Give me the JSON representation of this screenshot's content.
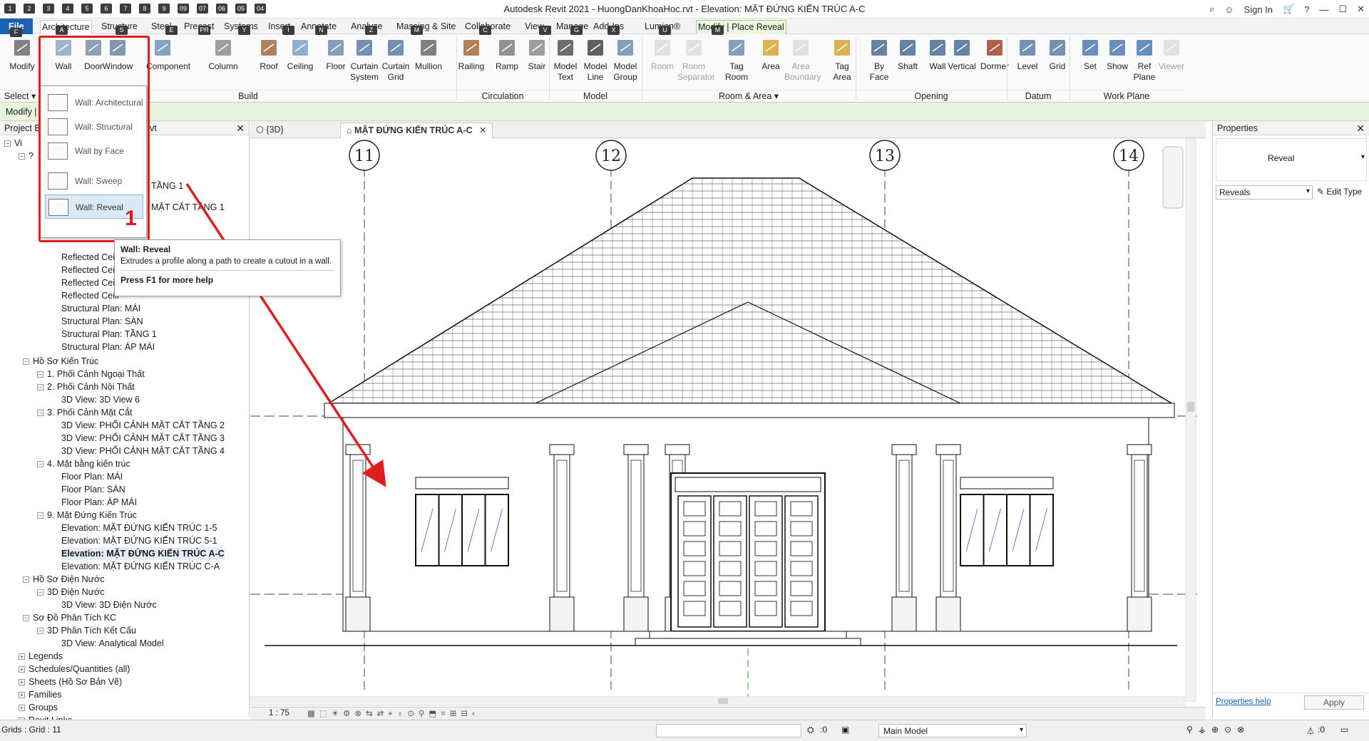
{
  "app": {
    "title": "Autodesk Revit 2021 - HuongDanKhoaHoc.rvt - Elevation: MẶT ĐỨNG KIẾN TRÚC A-C"
  },
  "qat": {
    "keytips": [
      "1",
      "2",
      "3",
      "4",
      "5",
      "6",
      "7",
      "8",
      "9",
      "09",
      "07",
      "06",
      "05",
      "04"
    ]
  },
  "titlebar_right": {
    "sign_in": "Sign In",
    "help": "?"
  },
  "ribbon_tabs": [
    {
      "label": "File",
      "keytip": "F"
    },
    {
      "label": "Architecture",
      "keytip": "A"
    },
    {
      "label": "Structure",
      "keytip": "S"
    },
    {
      "label": "Steel",
      "keytip": "E"
    },
    {
      "label": "Precast",
      "keytip": "PR"
    },
    {
      "label": "Systems",
      "keytip": "Y"
    },
    {
      "label": "Insert",
      "keytip": "I"
    },
    {
      "label": "Annotate",
      "keytip": "N"
    },
    {
      "label": "Analyze",
      "keytip": "Z"
    },
    {
      "label": "Massing & Site",
      "keytip": "M"
    },
    {
      "label": "Collaborate",
      "keytip": "C"
    },
    {
      "label": "View",
      "keytip": "V"
    },
    {
      "label": "Manage",
      "keytip": "G"
    },
    {
      "label": "Add-Ins",
      "keytip": "X"
    },
    {
      "label": "Lumion®",
      "keytip": "U"
    },
    {
      "label": "Modify | Place Reveal",
      "keytip": "M"
    }
  ],
  "ribbon": {
    "buttons": [
      "Modify",
      "Wall",
      "Door",
      "Window",
      "Component",
      "Column",
      "Roof",
      "Ceiling",
      "Floor",
      "Curtain\nSystem",
      "Curtain\nGrid",
      "Mullion",
      "Railing",
      "Ramp",
      "Stair",
      "Model\nText",
      "Model\nLine",
      "Model\nGroup",
      "Room",
      "Room\nSeparator",
      "Tag\nRoom",
      "Area",
      "Area\nBoundary",
      "Tag\nArea",
      "By\nFace",
      "Shaft",
      "Wall",
      "Vertical",
      "Dormer",
      "Level",
      "Grid",
      "Set",
      "Show",
      "Ref\nPlane",
      "Viewer"
    ],
    "groups": [
      "Select ▾",
      "Build",
      "Circulation",
      "Model",
      "Room & Area ▾",
      "Opening",
      "Datum",
      "Work Plane"
    ]
  },
  "options_bar": {
    "label": "Modify |"
  },
  "wall_menu": {
    "items": [
      "Wall: Architectural",
      "Wall: Structural",
      "Wall by Face",
      "Wall: Sweep",
      "Wall: Reveal"
    ]
  },
  "annotation": {
    "number": "1"
  },
  "tooltip": {
    "title": "Wall: Reveal",
    "description": "Extrudes a profile along a path to create a cutout in a wall.",
    "footer": "Press F1 for more help"
  },
  "browser": {
    "title": "Project Br",
    "title_tail": "vt",
    "nodes": [
      "Vi",
      "?",
      "TẦNG 1",
      "MẶT CẮT TẦNG 1",
      "Reflected Ceili",
      "Reflected Ceili",
      "Reflected Ceili",
      "Reflected Ceili",
      "Structural Plan: MÁI",
      "Structural Plan: SÀN",
      "Structural Plan: TẦNG 1",
      "Structural Plan: ÁP MÁI",
      "Hồ Sơ Kiến Trúc",
      "1. Phối Cảnh Ngoại Thất",
      "2. Phối Cảnh Nội Thất",
      "3D View: 3D View 6",
      "3. Phối Cảnh Mặt Cắt",
      "3D View: PHỐI CẢNH MẶT CẮT TẦNG 2",
      "3D View: PHỐI CẢNH MẶT CẮT TẦNG 3",
      "3D View: PHỐI CẢNH MẶT CẮT TẦNG 4",
      "4. Mặt bằng kiến trúc",
      "Floor Plan: MÁI",
      "Floor Plan: SÀN",
      "Floor Plan: ÁP MÁI",
      "9. Mặt Đứng Kiến Trúc",
      "Elevation: MẶT ĐỨNG KIẾN TRÚC 1-5",
      "Elevation: MẶT ĐỨNG KIẾN TRÚC 5-1",
      "Elevation: MẶT ĐỨNG KIẾN TRÚC A-C",
      "Elevation: MẶT ĐỨNG KIẾN TRÚC C-A",
      "Hồ Sơ Điện Nước",
      "3D Điện Nước",
      "3D View: 3D Điện Nước",
      "Sơ Đồ Phân Tích KC",
      "3D Phân Tích Kết Cấu",
      "3D View: Analytical Model",
      "Legends",
      "Schedules/Quantities (all)",
      "Sheets (Hồ Sơ Bản Vẽ)",
      "Families",
      "Groups",
      "Revit Links"
    ]
  },
  "view_tabs": [
    {
      "label": "{3D}"
    },
    {
      "label": "MẶT ĐỨNG KIẾN TRÚC A-C"
    }
  ],
  "grid_bubbles": [
    "11",
    "12",
    "13",
    "14"
  ],
  "view_control": {
    "scale": "1 : 75"
  },
  "properties": {
    "title": "Properties",
    "type_name": "Reveal",
    "selector": "Reveals",
    "edit_type": "Edit Type",
    "help_link": "Properties help",
    "apply": "Apply"
  },
  "status": {
    "text": "Grids : Grid : 11",
    "zero1": ":0",
    "model": "Main Model",
    "zero2": ":0"
  },
  "colors": {
    "file_tab": "#1b61b3",
    "context_tab": "#eaf6dd",
    "annotation_red": "#e01d1d"
  }
}
